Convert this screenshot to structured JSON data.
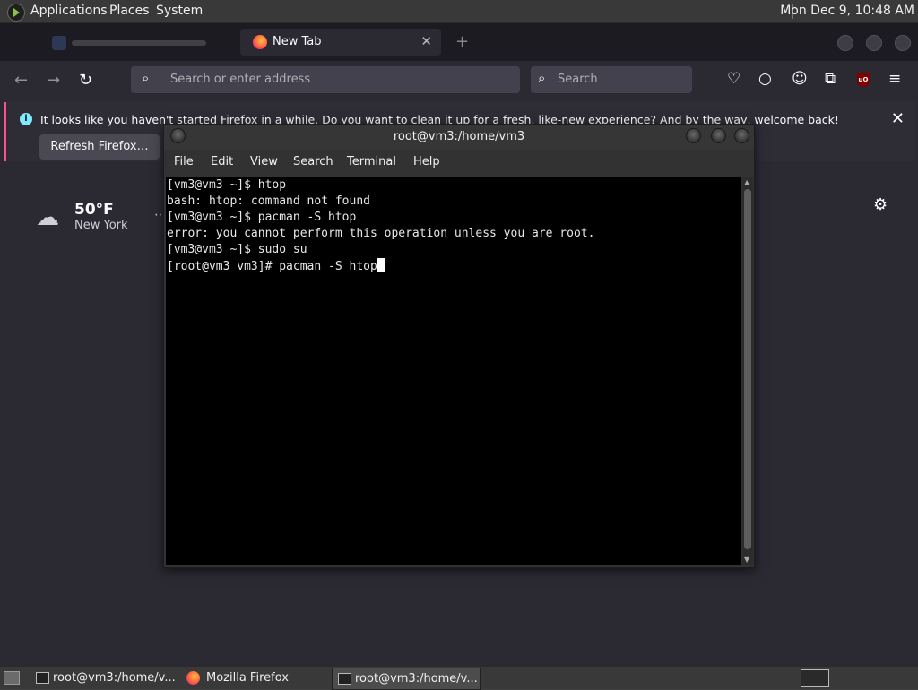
{
  "top_panel": {
    "menus": [
      "Applications",
      "Places",
      "System"
    ],
    "clock": "Mon Dec  9, 10:48 AM"
  },
  "firefox": {
    "active_tab_label": "New Tab",
    "url_placeholder": "Search or enter address",
    "search_placeholder": "Search",
    "notification_text": "It looks like you haven't started Firefox in a while. Do you want to clean it up for a fresh, like-new experience? And by the way, welcome back!",
    "refresh_button": "Refresh Firefox…",
    "weather": {
      "temperature": "50°F",
      "city": "New York"
    },
    "colors": {
      "accent": "#ff4f9a",
      "background": "#2b2a33"
    }
  },
  "terminal": {
    "title": "root@vm3:/home/vm3",
    "menu": [
      "File",
      "Edit",
      "View",
      "Search",
      "Terminal",
      "Help"
    ],
    "lines": [
      "[vm3@vm3 ~]$ htop",
      "bash: htop: command not found",
      "[vm3@vm3 ~]$ pacman -S htop",
      "error: you cannot perform this operation unless you are root.",
      "[vm3@vm3 ~]$ sudo su",
      "[root@vm3 vm3]# pacman -S htop"
    ]
  },
  "taskbar": {
    "tasks": [
      "root@vm3:/home/v...",
      "Mozilla Firefox",
      "root@vm3:/home/v..."
    ]
  }
}
